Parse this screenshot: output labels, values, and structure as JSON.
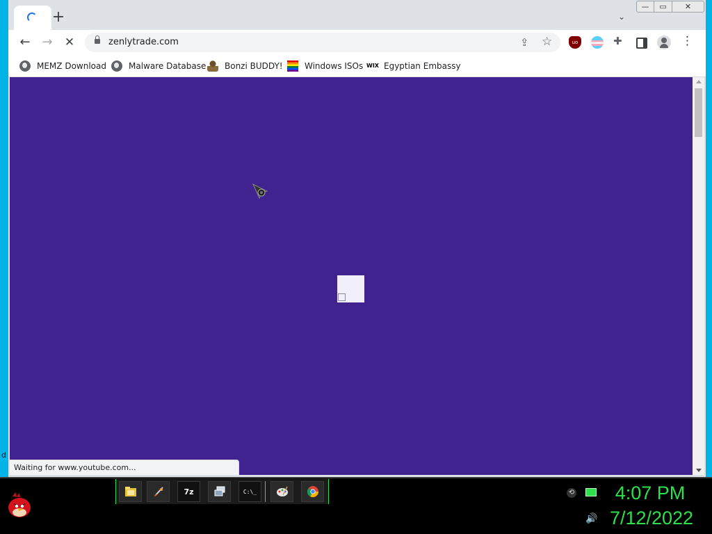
{
  "browser": {
    "tab": {
      "status": "loading"
    },
    "new_tab_label": "+",
    "tab_search_label": "⌄",
    "window_controls": {
      "minimize": "—",
      "maximize": "▭",
      "close": "✕"
    },
    "toolbar": {
      "back": "←",
      "forward": "→",
      "stop": "✕",
      "url": "zenlytrade.com",
      "menu": "⋮"
    },
    "bookmarks": [
      {
        "label": "MEMZ Download",
        "icon": "globe-icon"
      },
      {
        "label": "Malware Database",
        "icon": "globe-icon"
      },
      {
        "label": "Bonzi BUDDY!",
        "icon": "bonzi-icon"
      },
      {
        "label": "Windows ISOs",
        "icon": "rainbow-flag-icon"
      },
      {
        "label": "Egyptian Embassy",
        "icon": "wix-icon"
      }
    ],
    "bookmark_wix_text": "WIX",
    "extension_ublock_text": "uo",
    "status_text": "Waiting for www.youtube.com...",
    "page_background": "#40238f"
  },
  "desktop": {
    "edge_letter": "d"
  },
  "taskbar": {
    "clock_time": "4:07 PM",
    "clock_date": "7/12/2022",
    "accent_color": "#2ddf4b",
    "quick_launch": [
      {
        "name": "file-explorer-icon"
      },
      {
        "name": "paint-brush-icon"
      },
      {
        "name": "seven-zip-icon",
        "text": "7z"
      },
      {
        "name": "remote-desktop-icon"
      },
      {
        "name": "command-prompt-icon",
        "text": "C:\\_"
      },
      {
        "name": "paint-palette-icon"
      },
      {
        "name": "chrome-icon"
      }
    ]
  }
}
